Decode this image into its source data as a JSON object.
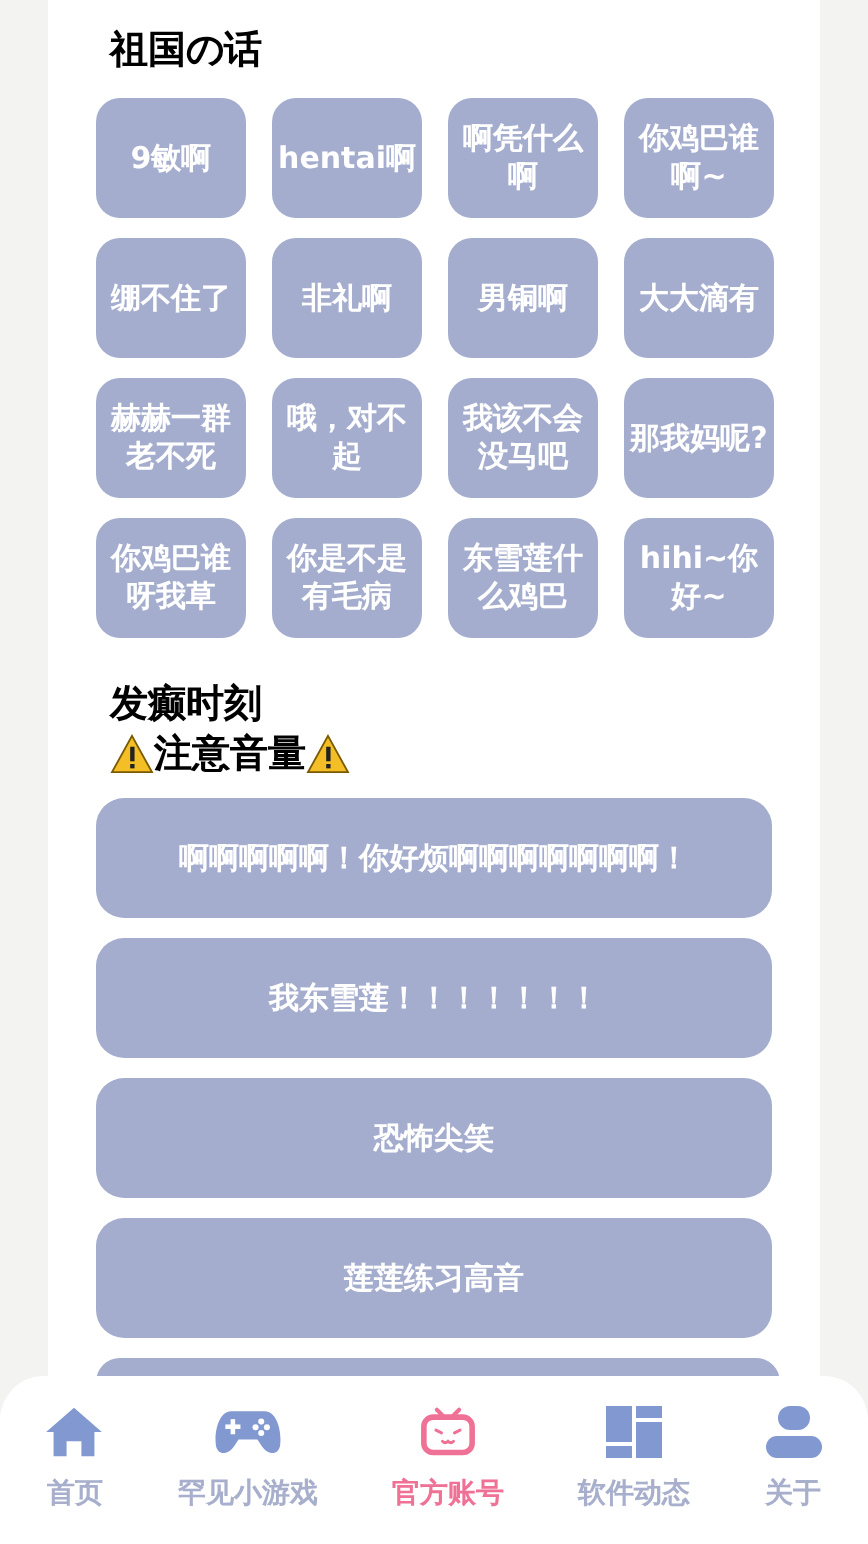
{
  "sections": [
    {
      "kind": "grid",
      "title": "祖国の话",
      "items": [
        "9敏啊",
        "hentai啊",
        "啊凭什么啊",
        "你鸡巴谁啊~",
        "绷不住了",
        "非礼啊",
        "男铜啊",
        "大大滴有",
        "赫赫一群老不死",
        "哦，对不起",
        "我该不会没马吧",
        "那我妈呢?",
        "你鸡巴谁呀我草",
        "你是不是有毛病",
        "东雪莲什么鸡巴",
        "hihi~你好~"
      ]
    },
    {
      "kind": "list",
      "title": "发癫时刻",
      "warning": "注意音量",
      "items": [
        "啊啊啊啊啊！你好烦啊啊啊啊啊啊啊！",
        "我东雪莲！！！！！！！",
        "恐怖尖笑",
        "莲莲练习高音"
      ],
      "more_below": true
    }
  ],
  "nav": [
    {
      "label": "首页",
      "selected": false
    },
    {
      "label": "罕见小游戏",
      "selected": false
    },
    {
      "label": "官方账号",
      "selected": true
    },
    {
      "label": "软件动态",
      "selected": false
    },
    {
      "label": "关于",
      "selected": false
    }
  ]
}
